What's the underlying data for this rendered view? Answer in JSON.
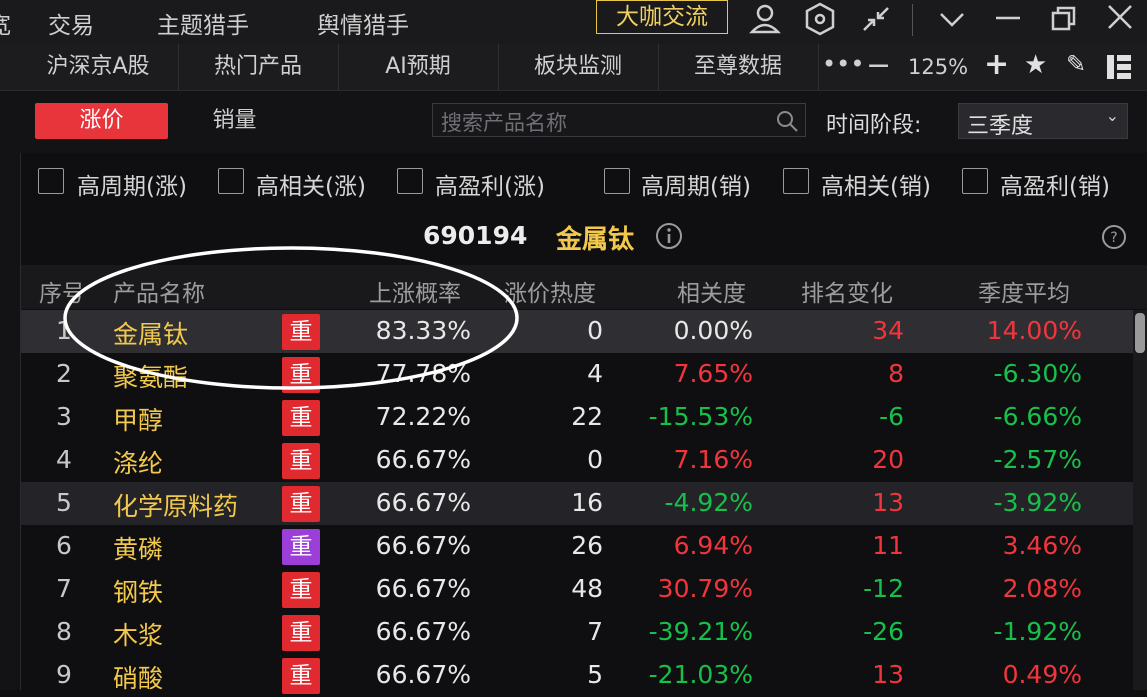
{
  "topbar": {
    "items": [
      "宽",
      "交易",
      "主题猎手",
      "舆情猎手"
    ],
    "promo": "大咖交流"
  },
  "secbar": {
    "tabs": [
      "沪深京A股",
      "热门产品",
      "AI预期",
      "板块监测",
      "至尊数据"
    ],
    "zoom": "125%"
  },
  "controls": {
    "rise_label": "涨价",
    "volume_label": "销量",
    "search_placeholder": "搜索产品名称",
    "period_label": "时间阶段:",
    "period_value": "三季度"
  },
  "filters": [
    "高周期(涨)",
    "高相关(涨)",
    "高盈利(涨)",
    "高周期(销)",
    "高相关(销)",
    "高盈利(销)"
  ],
  "title": {
    "code": "690194",
    "name": "金属钛"
  },
  "table": {
    "headers": [
      "序号",
      "产品名称",
      "上涨概率",
      "涨价热度",
      "相关度",
      "排名变化",
      "季度平均"
    ],
    "rows": [
      {
        "idx": "1",
        "name": "金属钛",
        "tag": "重",
        "tag_color": "red",
        "rise": "83.33%",
        "heat": "0",
        "corr": "0.00%",
        "corr_c": "white",
        "rank": "34",
        "rank_c": "red",
        "avg": "14.00%",
        "avg_c": "red"
      },
      {
        "idx": "2",
        "name": "聚氨酯",
        "tag": "重",
        "tag_color": "red",
        "rise": "77.78%",
        "heat": "4",
        "corr": "7.65%",
        "corr_c": "red",
        "rank": "8",
        "rank_c": "red",
        "avg": "-6.30%",
        "avg_c": "green"
      },
      {
        "idx": "3",
        "name": "甲醇",
        "tag": "重",
        "tag_color": "red",
        "rise": "72.22%",
        "heat": "22",
        "corr": "-15.53%",
        "corr_c": "green",
        "rank": "-6",
        "rank_c": "green",
        "avg": "-6.66%",
        "avg_c": "green"
      },
      {
        "idx": "4",
        "name": "涤纶",
        "tag": "重",
        "tag_color": "red",
        "rise": "66.67%",
        "heat": "0",
        "corr": "7.16%",
        "corr_c": "red",
        "rank": "20",
        "rank_c": "red",
        "avg": "-2.57%",
        "avg_c": "green"
      },
      {
        "idx": "5",
        "name": "化学原料药",
        "tag": "重",
        "tag_color": "red",
        "rise": "66.67%",
        "heat": "16",
        "corr": "-4.92%",
        "corr_c": "green",
        "rank": "13",
        "rank_c": "red",
        "avg": "-3.92%",
        "avg_c": "green"
      },
      {
        "idx": "6",
        "name": "黄磷",
        "tag": "重",
        "tag_color": "purple",
        "rise": "66.67%",
        "heat": "26",
        "corr": "6.94%",
        "corr_c": "red",
        "rank": "11",
        "rank_c": "red",
        "avg": "3.46%",
        "avg_c": "red"
      },
      {
        "idx": "7",
        "name": "钢铁",
        "tag": "重",
        "tag_color": "red",
        "rise": "66.67%",
        "heat": "48",
        "corr": "30.79%",
        "corr_c": "red",
        "rank": "-12",
        "rank_c": "green",
        "avg": "2.08%",
        "avg_c": "red"
      },
      {
        "idx": "8",
        "name": "木浆",
        "tag": "重",
        "tag_color": "red",
        "rise": "66.67%",
        "heat": "7",
        "corr": "-39.21%",
        "corr_c": "green",
        "rank": "-26",
        "rank_c": "green",
        "avg": "-1.92%",
        "avg_c": "green"
      },
      {
        "idx": "9",
        "name": "硝酸",
        "tag": "重",
        "tag_color": "red",
        "rise": "66.67%",
        "heat": "5",
        "corr": "-21.03%",
        "corr_c": "green",
        "rank": "13",
        "rank_c": "red",
        "avg": "0.49%",
        "avg_c": "red"
      }
    ]
  },
  "colors": {
    "accent_red": "#e8343b",
    "up": "#f0363c",
    "down": "#17c04a",
    "highlight": "#f2c94c"
  }
}
